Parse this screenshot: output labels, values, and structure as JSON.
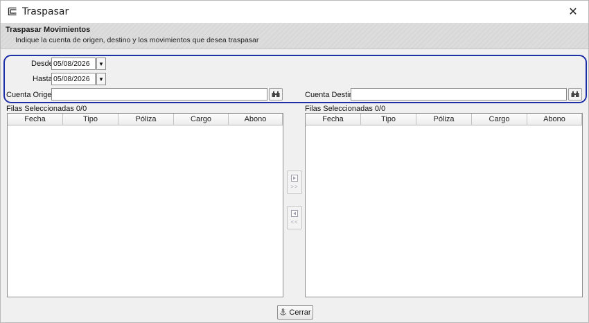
{
  "window": {
    "title": "Traspasar",
    "close_glyph": "✕"
  },
  "banner": {
    "title": "Traspasar Movimientos",
    "subtitle": "Indique la cuenta de origen, destino y los movimientos que desea traspasar"
  },
  "filters": {
    "desde_label": "Desde",
    "desde_value": "05/08/2026",
    "hasta_label": "Hasta",
    "hasta_value": "05/08/2026",
    "dropdown_glyph": "▼"
  },
  "origen": {
    "label": "Cuenta Origen",
    "value": "",
    "selected_rows": "Filas Seleccionadas",
    "selected_count": "0/0"
  },
  "destino": {
    "label": "Cuenta Destino",
    "value": "",
    "selected_rows": "Filas Seleccionadas",
    "selected_count": "0/0"
  },
  "table": {
    "columns": [
      "Fecha",
      "Tipo",
      "Póliza",
      "Cargo",
      "Abono"
    ]
  },
  "transfer": {
    "forward_glyph": ">>",
    "back_glyph": "<<"
  },
  "footer": {
    "close_label": "Cerrar"
  },
  "icons": {
    "app": "window-app-icon",
    "lookup": "binoculars-icon",
    "forward": "move-right-icon",
    "back": "move-left-icon",
    "close": "anchor-icon"
  },
  "colors": {
    "highlight": "#1f2fa8",
    "banner": "#d8d8d8",
    "panel": "#ffffff"
  }
}
